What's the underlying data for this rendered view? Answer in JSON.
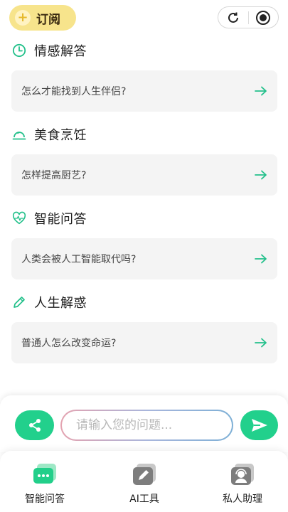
{
  "header": {
    "subscribe_label": "订阅",
    "plus_symbol": "+"
  },
  "colors": {
    "accent": "#22d08c",
    "subscribe_bg": "#f7e48c",
    "card_bg": "#f4f4f4"
  },
  "sections": [
    {
      "title": "情感解答",
      "icon": "clock-icon",
      "question": "怎么才能找到人生伴侣?"
    },
    {
      "title": "美食烹饪",
      "icon": "cloche-icon",
      "question": "怎样提高厨艺?"
    },
    {
      "title": "智能问答",
      "icon": "heart-pulse-icon",
      "question": "人类会被人工智能取代吗?"
    },
    {
      "title": "人生解惑",
      "icon": "pencil-icon",
      "question": "普通人怎么改变命运?"
    }
  ],
  "input": {
    "placeholder": "请输入您的问题..."
  },
  "tabs": [
    {
      "label": "智能问答",
      "icon": "chat-bubble-icon",
      "active": true
    },
    {
      "label": "AI工具",
      "icon": "edit-tool-icon",
      "active": false
    },
    {
      "label": "私人助理",
      "icon": "assistant-avatar-icon",
      "active": false
    }
  ]
}
